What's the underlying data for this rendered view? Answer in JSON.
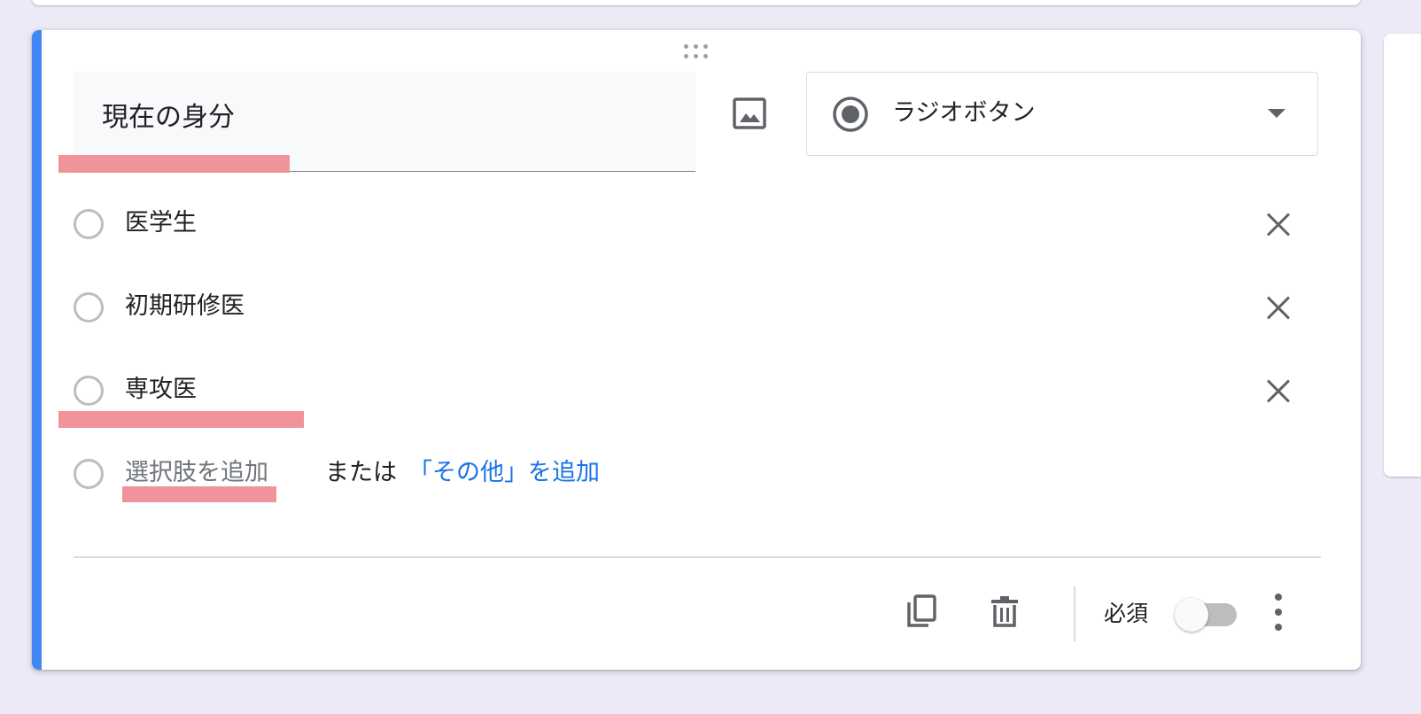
{
  "question": {
    "title": "現在の身分",
    "type_label": "ラジオボタン",
    "options": [
      {
        "label": "医学生"
      },
      {
        "label": "初期研修医"
      },
      {
        "label": "専攻医"
      }
    ],
    "add_option_placeholder": "選択肢を追加",
    "or_text": "または",
    "add_other_label": "「その他」を追加"
  },
  "footer": {
    "required_label": "必須",
    "required_on": false
  },
  "icons": {
    "image": "image-icon",
    "type_radio": "radio-checked-icon",
    "dropdown": "caret-down-icon",
    "remove": "close-icon",
    "duplicate": "copy-icon",
    "delete": "trash-icon",
    "more": "more-vert-icon",
    "drag": "drag-handle-icon"
  },
  "colors": {
    "accent": "#4285f4",
    "link": "#1a73e8",
    "highlight": "#ef8d95",
    "background": "#ede9f7"
  }
}
